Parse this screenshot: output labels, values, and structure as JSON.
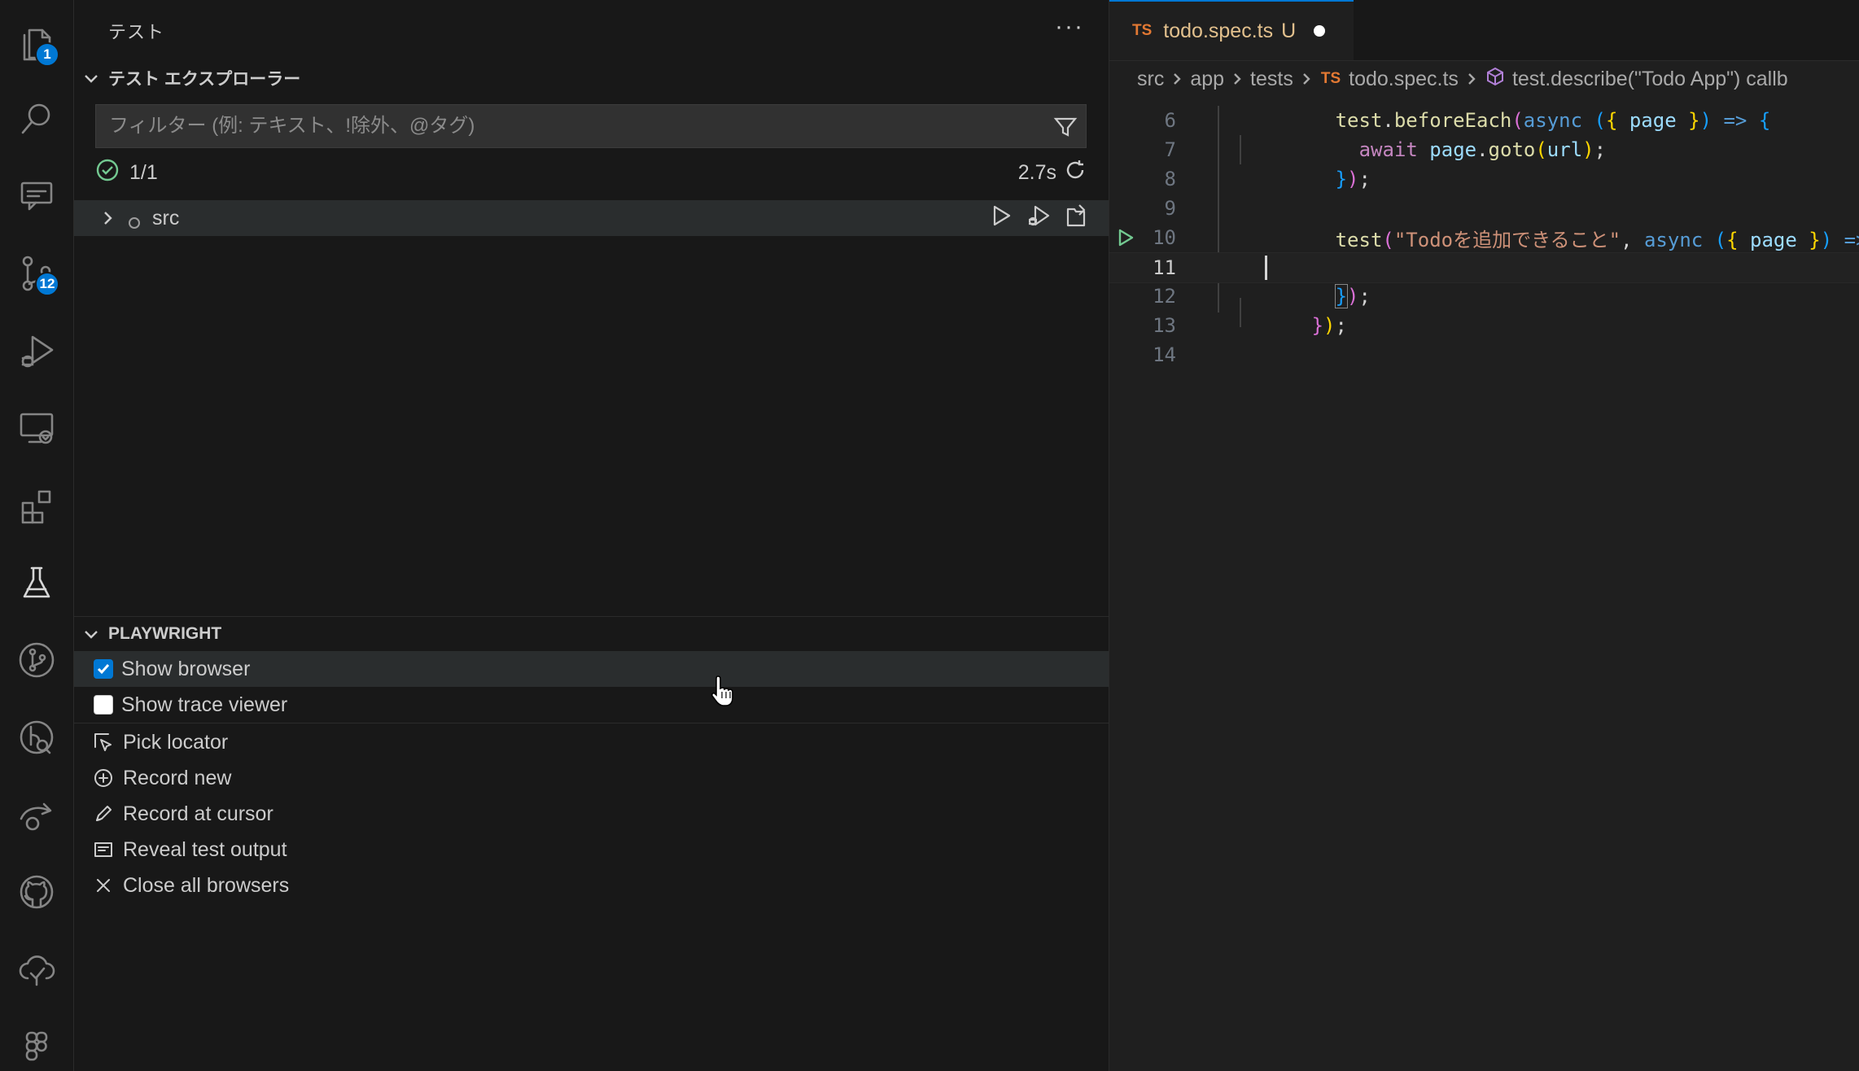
{
  "activity_bar": {
    "explorer_badge": "1",
    "scm_badge": "12"
  },
  "sidebar": {
    "title": "テスト",
    "more_label": "···",
    "test_explorer": {
      "header": "テスト エクスプローラー",
      "filter_placeholder": "フィルター (例: テキスト、!除外、@タグ)",
      "summary_count": "1/1",
      "summary_duration": "2.7s",
      "tree": [
        {
          "label": "src"
        }
      ]
    },
    "playwright": {
      "header": "PLAYWRIGHT",
      "checkboxes": [
        {
          "label": "Show browser",
          "checked": true
        },
        {
          "label": "Show trace viewer",
          "checked": false
        }
      ],
      "actions": [
        {
          "label": "Pick locator",
          "icon": "pick-locator-icon"
        },
        {
          "label": "Record new",
          "icon": "record-new-icon"
        },
        {
          "label": "Record at cursor",
          "icon": "pencil-icon"
        },
        {
          "label": "Reveal test output",
          "icon": "output-icon"
        },
        {
          "label": "Close all browsers",
          "icon": "close-icon"
        }
      ]
    }
  },
  "editor": {
    "tab": {
      "lang_badge": "TS",
      "filename": "todo.spec.ts",
      "status": "U"
    },
    "breadcrumb": {
      "parts": [
        "src",
        "app",
        "tests"
      ],
      "file_badge": "TS",
      "file": "todo.spec.ts",
      "symbol": "test.describe(\"Todo App\") callb"
    },
    "lines": [
      {
        "number": "6"
      },
      {
        "number": "7"
      },
      {
        "number": "8"
      },
      {
        "number": "9"
      },
      {
        "number": "10"
      },
      {
        "number": "11"
      },
      {
        "number": "12"
      },
      {
        "number": "13"
      },
      {
        "number": "14"
      }
    ],
    "code": {
      "l6": [
        "test",
        ".",
        "beforeEach",
        "(",
        "async",
        " ",
        "(",
        "{",
        " page ",
        "}",
        ")",
        " ",
        "=>",
        " ",
        "{"
      ],
      "l7": [
        "await",
        " ",
        "page",
        ".",
        "goto",
        "(",
        "url",
        ")",
        ";"
      ],
      "l8": [
        "}",
        ")",
        ";"
      ],
      "l10": [
        "test",
        "(",
        "\"Todoを追加できること\"",
        ", ",
        "async",
        " ",
        "(",
        "{",
        " page ",
        "}",
        ")",
        " ",
        "=>",
        " ",
        "{"
      ],
      "l12": [
        "}",
        ")",
        ";"
      ],
      "l13": [
        "}",
        ")",
        ";"
      ]
    },
    "colors": {
      "accent": "#0078d4",
      "test_passed": "#73c991",
      "ts_badge": "#e37933",
      "untracked": "#e2c08d"
    }
  }
}
